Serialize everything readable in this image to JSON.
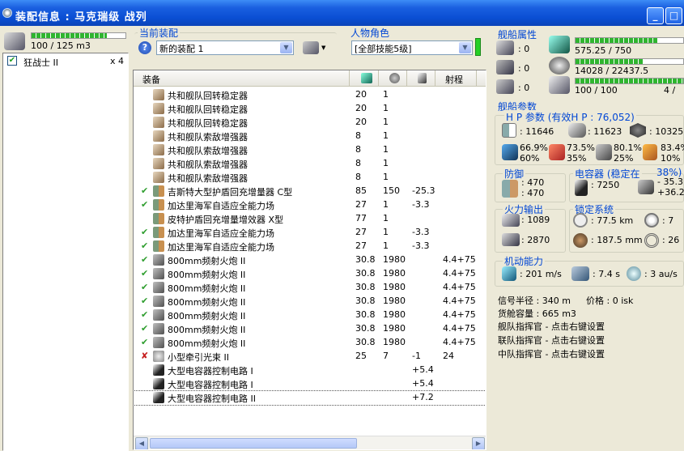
{
  "window": {
    "title": "装配信息 : 马克瑞级 战列",
    "buttons": {
      "minimize": "_",
      "maximize": "□"
    }
  },
  "left": {
    "drone_bay": "100 / 125 m3",
    "drone_bay_fill": 0.8,
    "drones": [
      {
        "name": "狂战士 II",
        "qty": "x 4",
        "checked": true
      }
    ]
  },
  "fitting": {
    "label": "当前装配",
    "selected": "新的装配 1"
  },
  "character": {
    "label": "人物角色",
    "selected": "[全部技能5级]"
  },
  "table": {
    "headers": [
      "装备",
      "",
      "",
      "",
      "射程"
    ],
    "rows": [
      {
        "state": "",
        "icon": "rig",
        "name": "共和舰队回转稳定器",
        "c1": "20",
        "c2": "1",
        "c3": "",
        "c4": ""
      },
      {
        "state": "",
        "icon": "rig",
        "name": "共和舰队回转稳定器",
        "c1": "20",
        "c2": "1",
        "c3": "",
        "c4": ""
      },
      {
        "state": "",
        "icon": "rig",
        "name": "共和舰队回转稳定器",
        "c1": "20",
        "c2": "1",
        "c3": "",
        "c4": ""
      },
      {
        "state": "",
        "icon": "rig",
        "name": "共和舰队索敌增强器",
        "c1": "8",
        "c2": "1",
        "c3": "",
        "c4": ""
      },
      {
        "state": "",
        "icon": "rig",
        "name": "共和舰队索敌增强器",
        "c1": "8",
        "c2": "1",
        "c3": "",
        "c4": ""
      },
      {
        "state": "",
        "icon": "rig",
        "name": "共和舰队索敌增强器",
        "c1": "8",
        "c2": "1",
        "c3": "",
        "c4": ""
      },
      {
        "state": "",
        "icon": "rig",
        "name": "共和舰队索敌增强器",
        "c1": "8",
        "c2": "1",
        "c3": "",
        "c4": ""
      },
      {
        "state": "✔",
        "icon": "shield",
        "name": "吉斯特大型护盾回充增量器 C型",
        "c1": "85",
        "c2": "150",
        "c3": "-25.3",
        "c4": ""
      },
      {
        "state": "✔",
        "icon": "shield",
        "name": "加达里海军自适应全能力场",
        "c1": "27",
        "c2": "1",
        "c3": "-3.3",
        "c4": ""
      },
      {
        "state": "",
        "icon": "shield",
        "name": "皮特护盾回充增量增效器 X型",
        "c1": "77",
        "c2": "1",
        "c3": "",
        "c4": ""
      },
      {
        "state": "✔",
        "icon": "shield",
        "name": "加达里海军自适应全能力场",
        "c1": "27",
        "c2": "1",
        "c3": "-3.3",
        "c4": ""
      },
      {
        "state": "✔",
        "icon": "shield",
        "name": "加达里海军自适应全能力场",
        "c1": "27",
        "c2": "1",
        "c3": "-3.3",
        "c4": ""
      },
      {
        "state": "✔",
        "icon": "gun",
        "name": "800mm频射火炮 II",
        "c1": "30.8",
        "c2": "1980",
        "c3": "",
        "c4": "4.4+75"
      },
      {
        "state": "✔",
        "icon": "gun",
        "name": "800mm频射火炮 II",
        "c1": "30.8",
        "c2": "1980",
        "c3": "",
        "c4": "4.4+75"
      },
      {
        "state": "✔",
        "icon": "gun",
        "name": "800mm频射火炮 II",
        "c1": "30.8",
        "c2": "1980",
        "c3": "",
        "c4": "4.4+75"
      },
      {
        "state": "✔",
        "icon": "gun",
        "name": "800mm频射火炮 II",
        "c1": "30.8",
        "c2": "1980",
        "c3": "",
        "c4": "4.4+75"
      },
      {
        "state": "✔",
        "icon": "gun",
        "name": "800mm频射火炮 II",
        "c1": "30.8",
        "c2": "1980",
        "c3": "",
        "c4": "4.4+75"
      },
      {
        "state": "✔",
        "icon": "gun",
        "name": "800mm频射火炮 II",
        "c1": "30.8",
        "c2": "1980",
        "c3": "",
        "c4": "4.4+75"
      },
      {
        "state": "✔",
        "icon": "gun",
        "name": "800mm频射火炮 II",
        "c1": "30.8",
        "c2": "1980",
        "c3": "",
        "c4": "4.4+75"
      },
      {
        "state": "✘",
        "icon": "tractor",
        "name": "小型牵引光束 II",
        "c1": "25",
        "c2": "7",
        "c3": "-1",
        "c4": "24"
      },
      {
        "state": "",
        "icon": "cap",
        "name": "大型电容器控制电路 I",
        "c1": "",
        "c2": "",
        "c3": "+5.4",
        "c4": ""
      },
      {
        "state": "",
        "icon": "cap",
        "name": "大型电容器控制电路 I",
        "c1": "",
        "c2": "",
        "c3": "+5.4",
        "c4": ""
      },
      {
        "state": "",
        "icon": "cap",
        "name": "大型电容器控制电路 II",
        "c1": "",
        "c2": "",
        "c3": "+7.2",
        "c4": ""
      }
    ]
  },
  "ship_attr": {
    "label": "舰船属性",
    "slots": [
      ": 0",
      ": 0",
      ": 0"
    ],
    "cpu": "575.25 / 750",
    "cpu_fill": 0.77,
    "power": "14028 / 22437.5",
    "power_fill": 0.63,
    "calib": "100 / 100",
    "calib_fill": 1.0,
    "calib_right": "4 /"
  },
  "ship_params": {
    "label": "舰船参数",
    "hp_label": "H P 参数 (有效H P :",
    "hp_value": "76,052)",
    "hp": [
      ": 11646",
      ": 11623",
      ": 10325"
    ],
    "res1": [
      "66.9%",
      "73.5%",
      "80.1%",
      "83.4%"
    ],
    "res2": [
      "60%",
      "35%",
      "25%",
      "10%"
    ]
  },
  "defense": {
    "label": "防御",
    "v1": ": 470",
    "v2": ": 470"
  },
  "capacitor": {
    "label": "电容器 (稳定在",
    "percent": "38%)",
    "amount": ": 7250",
    "delta1": "- 35.3",
    "delta2": "+36.2"
  },
  "firepower": {
    "label": "火力输出",
    "v1": ": 1089",
    "v2": ": 2870"
  },
  "targeting": {
    "label": "锁定系统",
    "range": ": 77.5 km",
    "targets": ": 7",
    "scan_res": ": 187.5 mm",
    "sensor": ": 26"
  },
  "mobility": {
    "label": "机动能力",
    "speed": ": 201 m/s",
    "align": ": 7.4 s",
    "warp": ": 3 au/s"
  },
  "info": {
    "signature": "信号半径 : 340 m",
    "price": "价格 : 0 isk",
    "cargo": "货舱容量 : 665 m3",
    "commanders": [
      "舰队指挥官 - 点击右键设置",
      "联队指挥官 - 点击右键设置",
      "中队指挥官 - 点击右键设置"
    ]
  }
}
